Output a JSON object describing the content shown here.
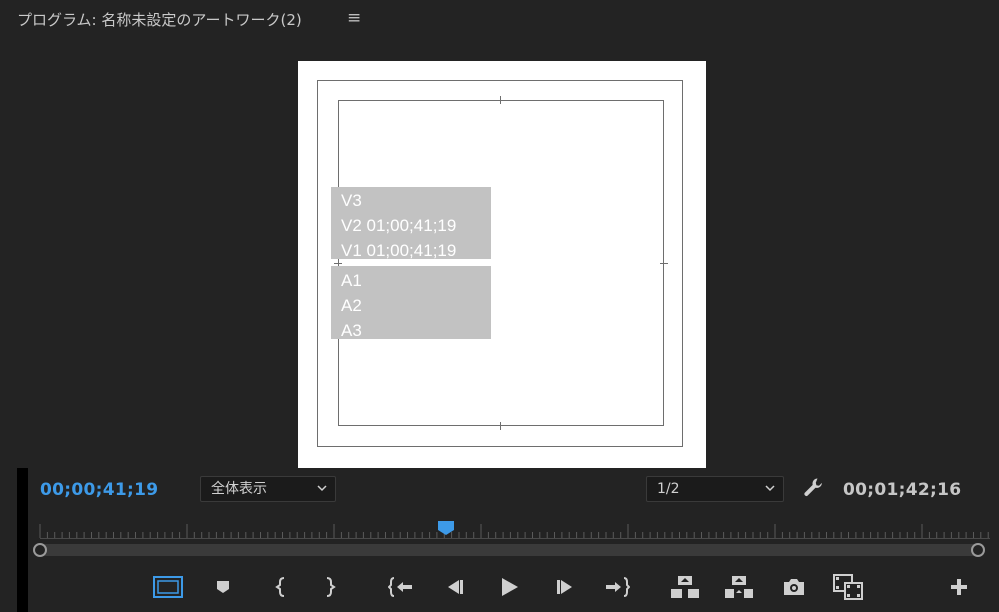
{
  "panel": {
    "title": "プログラム: 名称未設定のアートワーク(2)",
    "menu_glyph": "≡"
  },
  "overlay": {
    "video_tracks": [
      "V3",
      "V2 01;00;41;19",
      "V1 01;00;41;19"
    ],
    "audio_tracks": [
      "A1",
      "A2",
      "A3"
    ]
  },
  "controls": {
    "current_timecode": "00;00;41;19",
    "duration_timecode": "00;01;42;16",
    "zoom_select": "全体表示",
    "resolution_select": "1/2"
  },
  "transport_icons": [
    "safe-margins-icon",
    "add-marker-icon",
    "mark-in-icon",
    "mark-out-icon",
    "go-to-in-icon",
    "step-back-icon",
    "play-icon",
    "step-forward-icon",
    "go-to-out-icon",
    "lift-icon",
    "extract-icon",
    "export-frame-icon",
    "compare-view-icon",
    "button-editor-icon"
  ],
  "colors": {
    "accent": "#3d9ae8",
    "background": "#232323",
    "icon": "#cfcfcf"
  }
}
